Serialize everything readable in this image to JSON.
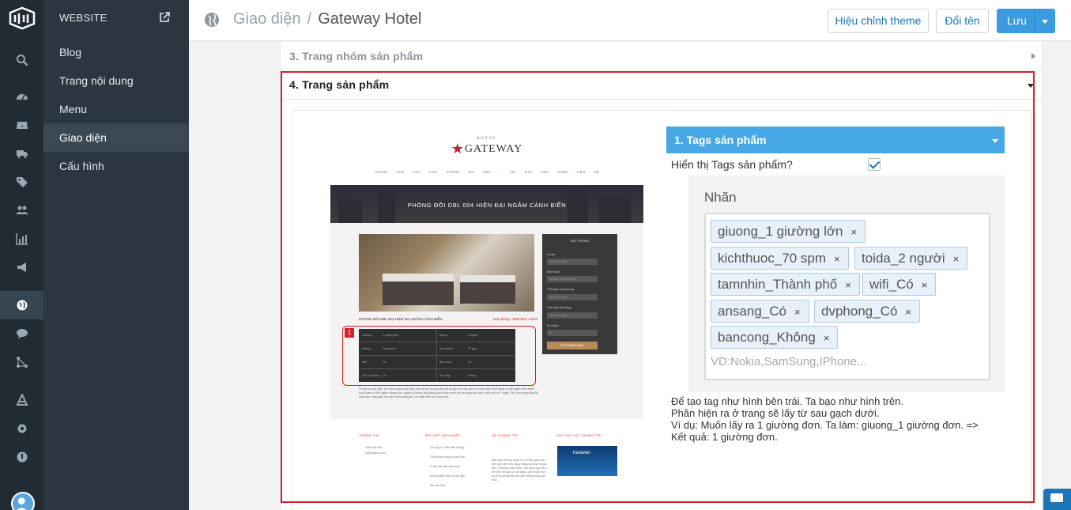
{
  "sidebar": {
    "header": "WEBSITE",
    "items": [
      {
        "label": "Blog",
        "active": false
      },
      {
        "label": "Trang nội dung",
        "active": false
      },
      {
        "label": "Menu",
        "active": false
      },
      {
        "label": "Giao diện",
        "active": true
      },
      {
        "label": "Cấu hình",
        "active": false
      }
    ]
  },
  "rail": {
    "icons": [
      "search-icon",
      "dashboard-icon",
      "inbox-icon",
      "truck-icon",
      "tag-icon",
      "users-icon",
      "chart-icon",
      "megaphone-icon",
      "globe-icon",
      "chat-icon",
      "flow-icon",
      "apps-icon",
      "settings-icon",
      "info-icon",
      "avatar"
    ],
    "active": "globe-icon"
  },
  "breadcrumb": {
    "parent": "Giao diện",
    "separator": "/",
    "current": "Gateway Hotel"
  },
  "toolbar": {
    "edit_theme": "Hiệu chỉnh theme",
    "rename": "Đổi tên",
    "save": "Lưu"
  },
  "sections": {
    "sec3": "3. Trang nhóm sản phẩm",
    "sec4": "4. Trang sản phẩm"
  },
  "preview": {
    "logo_small": "HOTEL",
    "logo": "GATEWAY",
    "nav": "TRANG CHỦ  CÁC LOẠI PHÒNG  BÀI VIẾT - TIN TỨC  GIỚI THIỆU  LIÊN HỆ",
    "hero_title": "PHÒNG ĐÔI DBL 004 HIỆN ĐẠI NGẮM CẢNH BIỂN",
    "caption": "PHÒNG ĐÔI DBL 004 HIỆN ĐẠI NGẮM CẢNH BIỂN",
    "price": "Giá phòng : 999.000₫ / Đêm",
    "marker": "1",
    "table": [
      [
        "Giường",
        "1 giường lớn",
        "Người",
        "2 người"
      ],
      [
        "Hướng",
        "Thành phố",
        "Kích thước",
        "70 spm"
      ],
      [
        "Wifi",
        "Có",
        "Ban công",
        "Có"
      ],
      [
        "Dịch vụ phòng",
        "Có",
        "Ăn sáng",
        "Không"
      ]
    ],
    "desc": "Phòng hướng biển, với cảnh quan tuyệt đẹp, bạn sẽ tận hưởng đầy đủ kỳ nghỉ với các dịch vụ hoàn hảo. Buổi sáng có thể ngắm bình minh, buổi chiều có thể ngắm hoàng hôn, ngoài ra khách đặt phòng còn được miễn phí ăn sáng các buổi, miễn phí xe 7 ngày. Tiện ích phòng đầy đủ máy lạnh, máy giặt, tivi màn hình phẳng 40\" và nhiều tiện ích khác nữa.",
    "booking": {
      "title": "ĐẶT PHÒNG",
      "email": "E-mail",
      "email_ph": "Email của bạn",
      "phone": "Điện thoại",
      "phone_ph": "Số điện thoại của bạn",
      "checkin": "Thời gian nhận phòng",
      "checkin_ph": "Chọn thời gian",
      "checkout": "Thời gian trả phòng",
      "checkout_ph": "Chọn thời gian",
      "guests": "Số khách",
      "guests_val": "1",
      "submit": "ĐẶT PHÒNG NGAY"
    },
    "footer": {
      "col1": "THÔNG TIN",
      "col1_lines": [
        "1900.656.090",
        "hi@haravan.com"
      ],
      "col2": "BÀI VIẾT MỚI NHẤT",
      "col2_lines": [
        "Chợ Nga - Điểm đến không...",
        "Thử thách cùng trò chơi dân...",
        "Tỉ tiện sân làm say lòng...",
        "Những điểm đến ưu lãn đầu...",
        "Bài viết mẫu"
      ],
      "col3": "VỀ CHÚNG TÔI",
      "col3_text": "Bạn ngồi thưởng tuyệt vời, mở lên giản sau thời gian làm việc căng thẳng của bạn và gia đình. Oriental Hotel được xây dựng dọc theo bờ biển nổi bật với cát trắng, cảnh tuyệt vời, là nơi lý tưởng để bạn nghỉ dưỡng cùng gia đình.",
      "col4": "KẾT NỐI VỚI CHÚNG TÔI",
      "ad_text": "haravan"
    }
  },
  "tags_panel": {
    "title": "1. Tags sản phẩm",
    "show_label": "Hiển thị Tags sản phẩm?",
    "checked": true,
    "example_label": "Nhãn",
    "tags": [
      "giuong_1 giường lớn",
      "kichthuoc_70 spm",
      "toida_2 người",
      "tamnhin_Thành phố",
      "wifi_Có",
      "ansang_Có",
      "dvphong_Có",
      "bancong_Không"
    ],
    "remove_glyph": "×",
    "placeholder": "VD:Nokia,SamSung,IPhone...",
    "notes": [
      "Để tạo tag như hình bên trái. Ta bạo như hình trên.",
      "Phần hiện ra ở trang sẽ lấy từ sau gạch dưới.",
      "Ví dụ: Muốn lấy ra 1 giường đơn. Ta làm: giuong_1 giường đơn. =>",
      "Kết quả: 1 giường đơn."
    ]
  }
}
